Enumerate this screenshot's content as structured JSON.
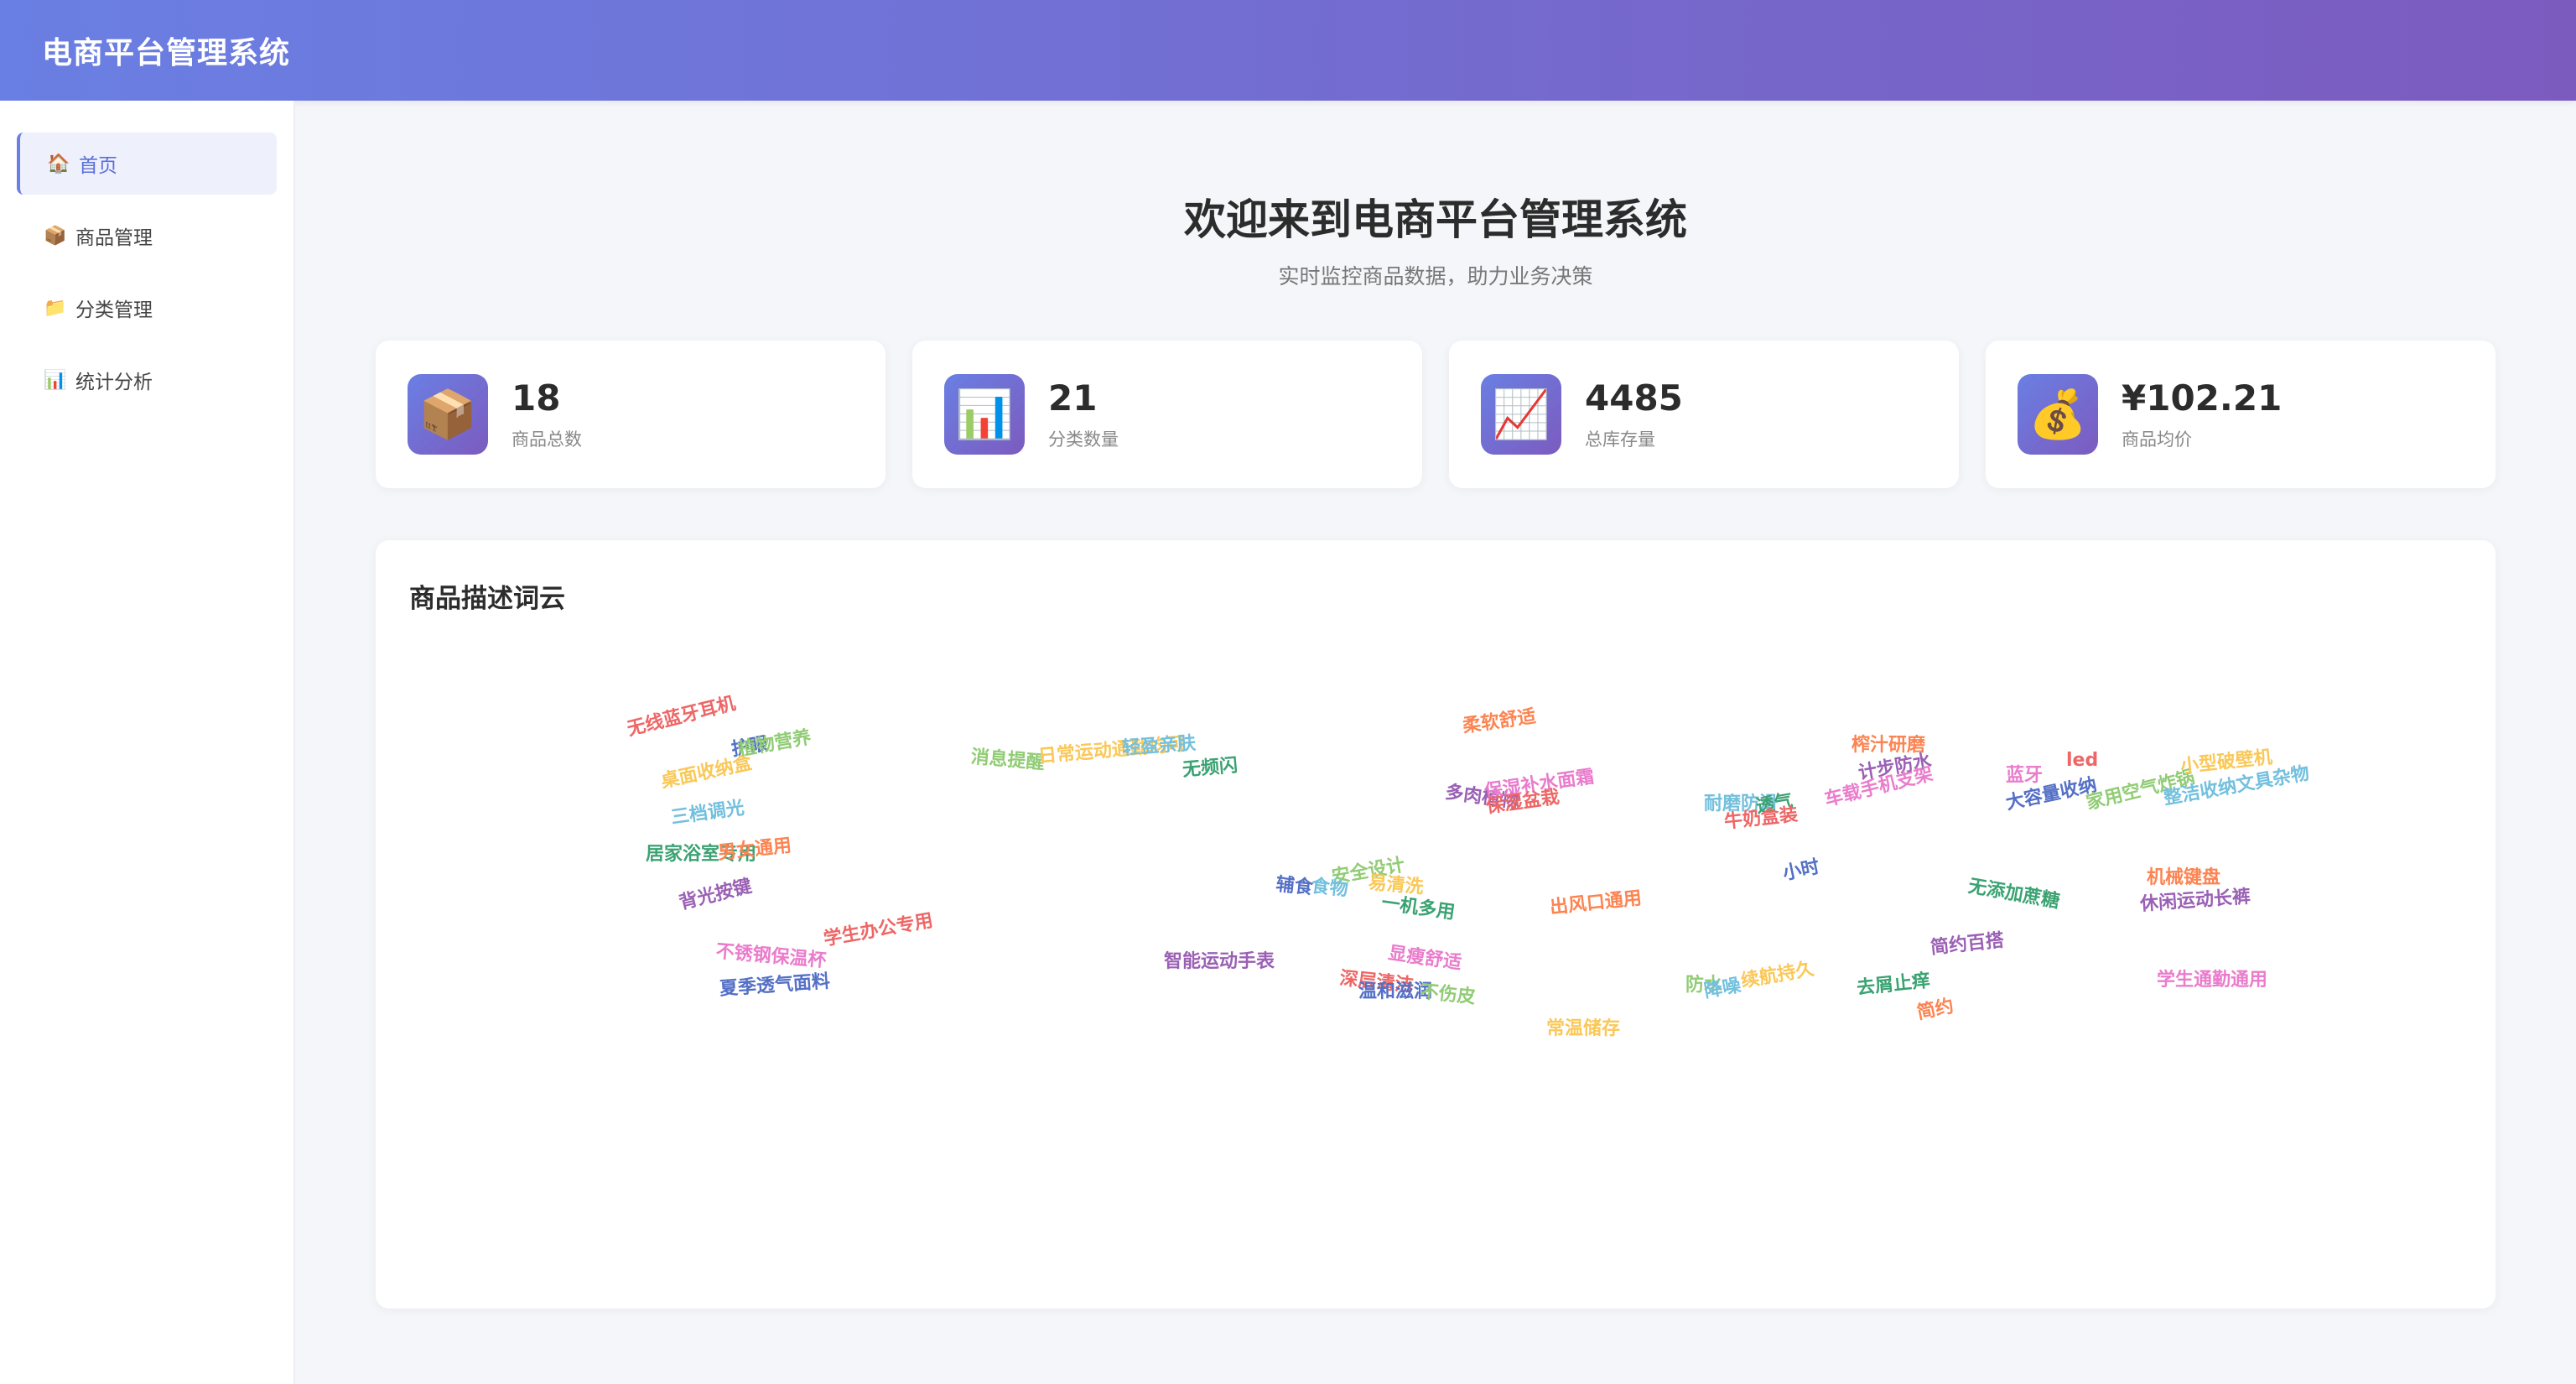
{
  "app": {
    "title": "电商平台管理系统"
  },
  "sidebar": {
    "items": [
      {
        "label": "首页",
        "icon": "🏠",
        "active": true
      },
      {
        "label": "商品管理",
        "icon": "📦"
      },
      {
        "label": "分类管理",
        "icon": "📁"
      },
      {
        "label": "统计分析",
        "icon": "📊"
      }
    ]
  },
  "welcome": {
    "title": "欢迎来到电商平台管理系统",
    "subtitle": "实时监控商品数据，助力业务决策"
  },
  "stats": [
    {
      "value": "18",
      "label": "商品总数",
      "icon": "📦"
    },
    {
      "value": "21",
      "label": "分类数量",
      "icon": "📊"
    },
    {
      "value": "4485",
      "label": "总库存量",
      "icon": "📈"
    },
    {
      "value": "¥102.21",
      "label": "商品均价",
      "icon": "💰"
    }
  ],
  "wordcloud": {
    "title": "商品描述词云",
    "colors": [
      "#ee6666",
      "#5470c6",
      "#91cc75",
      "#fac858",
      "#73c0de",
      "#3ba272",
      "#fc8452",
      "#9a60b4",
      "#ea7ccc"
    ],
    "words": [
      "无线蓝牙耳机",
      "护眼",
      "植物营养",
      "桌面收纳盒",
      "三档调光",
      "居家浴室专用",
      "男女通用",
      "背光按键",
      "不锈钢保温杯",
      "学生办公专用",
      "夏季透气面料",
      "消息提醒",
      "日常运动通勤均可",
      "轻盈亲肤",
      "无频闪",
      "柔软舒适",
      "多肉植物",
      "保湿补水面霜",
      "保湿盆栽",
      "辅食",
      "安全设计",
      "易清洗",
      "食物",
      "一机多用",
      "出风口通用",
      "智能运动手表",
      "显瘦舒适",
      "深层清洁",
      "温和滋润",
      "不伤皮",
      "常温储存",
      "耐磨防滑",
      "透气",
      "榨汁研磨",
      "计步防水",
      "车载手机支架",
      "牛奶盒装",
      "小时",
      "防水",
      "续航持久",
      "降噪",
      "去屑止痒",
      "简约",
      "简约百搭",
      "蓝牙",
      "led",
      "大容量收纳",
      "家用空气炸锅",
      "小型破壁机",
      "整洁收纳文具杂物",
      "无添加蔗糖",
      "机械键盘",
      "休闲运动长裤",
      "学生通勤通用"
    ]
  }
}
